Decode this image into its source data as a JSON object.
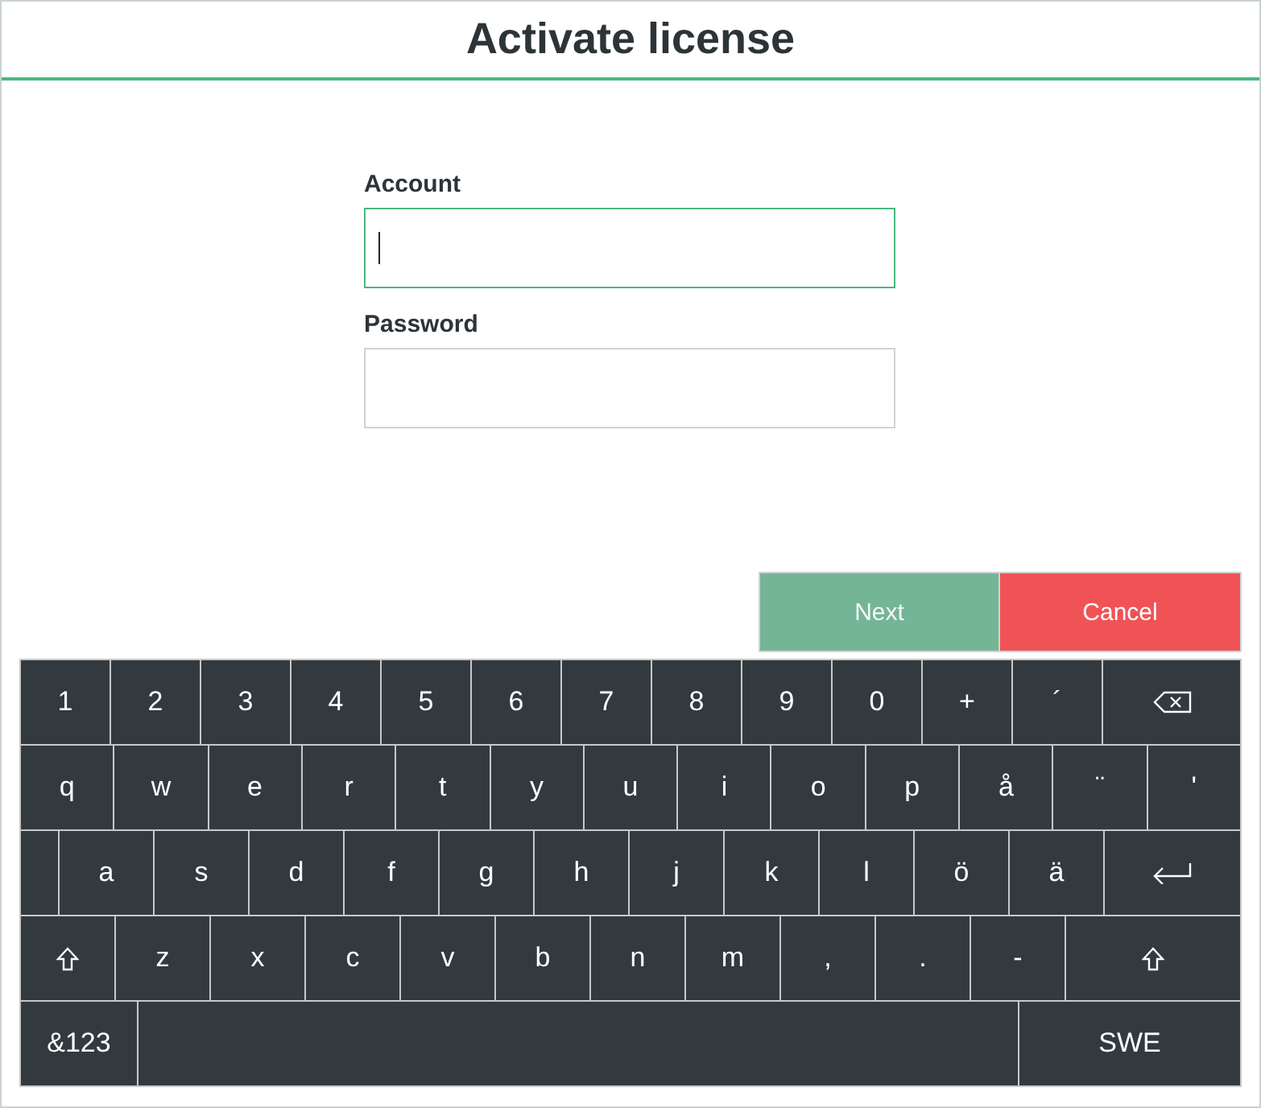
{
  "window": {
    "title": "Activate license"
  },
  "fields": [
    {
      "label": "Account",
      "focused": true
    },
    {
      "label": "Password",
      "focused": false
    }
  ],
  "buttons": [
    {
      "label": "Next",
      "kind": "confirm",
      "disabled": true
    },
    {
      "label": "Cancel",
      "kind": "cancel",
      "disabled": false
    }
  ],
  "keyboard": {
    "rows": [
      [
        {
          "kind": "char",
          "label": "1"
        },
        {
          "kind": "char",
          "label": "2"
        },
        {
          "kind": "char",
          "label": "3"
        },
        {
          "kind": "char",
          "label": "4"
        },
        {
          "kind": "char",
          "label": "5"
        },
        {
          "kind": "char",
          "label": "6"
        },
        {
          "kind": "char",
          "label": "7"
        },
        {
          "kind": "char",
          "label": "8"
        },
        {
          "kind": "char",
          "label": "9"
        },
        {
          "kind": "char",
          "label": "0"
        },
        {
          "kind": "char",
          "label": "+"
        },
        {
          "kind": "char",
          "label": "´"
        },
        {
          "kind": "backspace"
        }
      ],
      [
        {
          "kind": "char",
          "label": "q"
        },
        {
          "kind": "char",
          "label": "w"
        },
        {
          "kind": "char",
          "label": "e"
        },
        {
          "kind": "char",
          "label": "r"
        },
        {
          "kind": "char",
          "label": "t"
        },
        {
          "kind": "char",
          "label": "y"
        },
        {
          "kind": "char",
          "label": "u"
        },
        {
          "kind": "char",
          "label": "i"
        },
        {
          "kind": "char",
          "label": "o"
        },
        {
          "kind": "char",
          "label": "p"
        },
        {
          "kind": "char",
          "label": "å"
        },
        {
          "kind": "char",
          "label": "¨"
        },
        {
          "kind": "char",
          "label": "'"
        }
      ],
      [
        {
          "kind": "blank"
        },
        {
          "kind": "char",
          "label": "a"
        },
        {
          "kind": "char",
          "label": "s"
        },
        {
          "kind": "char",
          "label": "d"
        },
        {
          "kind": "char",
          "label": "f"
        },
        {
          "kind": "char",
          "label": "g"
        },
        {
          "kind": "char",
          "label": "h"
        },
        {
          "kind": "char",
          "label": "j"
        },
        {
          "kind": "char",
          "label": "k"
        },
        {
          "kind": "char",
          "label": "l"
        },
        {
          "kind": "char",
          "label": "ö"
        },
        {
          "kind": "char",
          "label": "ä"
        },
        {
          "kind": "enter"
        }
      ],
      [
        {
          "kind": "shift"
        },
        {
          "kind": "char",
          "label": "z"
        },
        {
          "kind": "char",
          "label": "x"
        },
        {
          "kind": "char",
          "label": "c"
        },
        {
          "kind": "char",
          "label": "v"
        },
        {
          "kind": "char",
          "label": "b"
        },
        {
          "kind": "char",
          "label": "n"
        },
        {
          "kind": "char",
          "label": "m"
        },
        {
          "kind": "char",
          "label": ","
        },
        {
          "kind": "char",
          "label": "."
        },
        {
          "kind": "char",
          "label": "-"
        },
        {
          "kind": "shift"
        }
      ],
      [
        {
          "kind": "char",
          "label": "&123"
        },
        {
          "kind": "space"
        },
        {
          "kind": "char",
          "label": "SWE"
        }
      ]
    ]
  }
}
